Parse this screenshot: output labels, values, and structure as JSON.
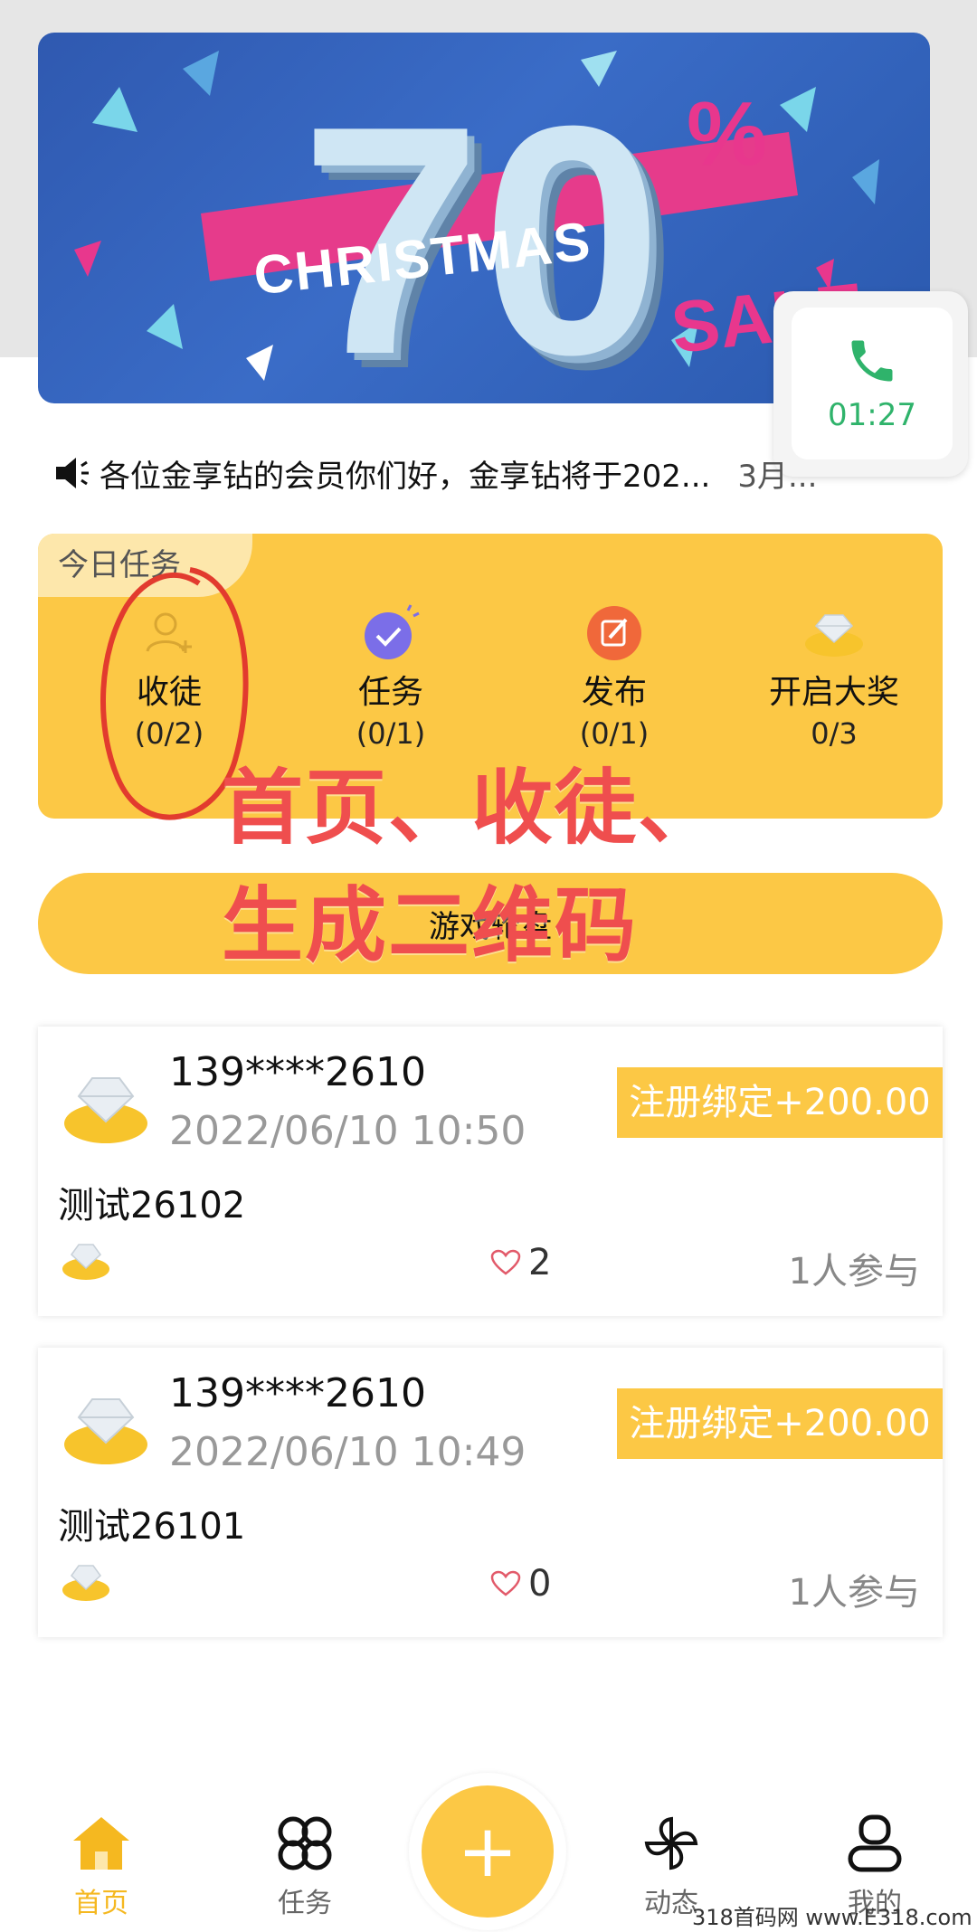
{
  "banner": {
    "number": "70",
    "percent": "%",
    "christmas": "CHRISTMAS",
    "sale": "SALE"
  },
  "call_widget": {
    "time": "01:27"
  },
  "notice": {
    "text": "各位金享钻的会员你们好，金享钻将于202...",
    "extra": "3月..."
  },
  "tasks": {
    "badge": "今日任务",
    "items": [
      {
        "label": "收徒",
        "count": "(0/2)"
      },
      {
        "label": "任务",
        "count": "(0/1)"
      },
      {
        "label": "发布",
        "count": "(0/1)"
      },
      {
        "label": "开启大奖",
        "count": "0/3"
      }
    ]
  },
  "overlay": {
    "line1": "首页、收徒、",
    "line2": "生成二维码"
  },
  "wheel_button": {
    "label": "游戏轮盘"
  },
  "feed": [
    {
      "user": "139****2610",
      "time": "2022/06/10 10:50",
      "reward": "注册绑定+200.00",
      "title": "测试26102",
      "likes": "2",
      "participants": "1人参与"
    },
    {
      "user": "139****2610",
      "time": "2022/06/10 10:49",
      "reward": "注册绑定+200.00",
      "title": "测试26101",
      "likes": "0",
      "participants": "1人参与"
    }
  ],
  "nav": {
    "home": "首页",
    "tasks": "任务",
    "fab": "+",
    "moments": "动态",
    "mine": "我的"
  },
  "watermark": "318首码网 www.E318.com",
  "colors": {
    "accent_yellow": "#fcc845",
    "call_green": "#2fb36b",
    "overlay_red": "#ef4e4e",
    "banner_blue": "#2f59b0",
    "banner_pink": "#e8378d"
  }
}
